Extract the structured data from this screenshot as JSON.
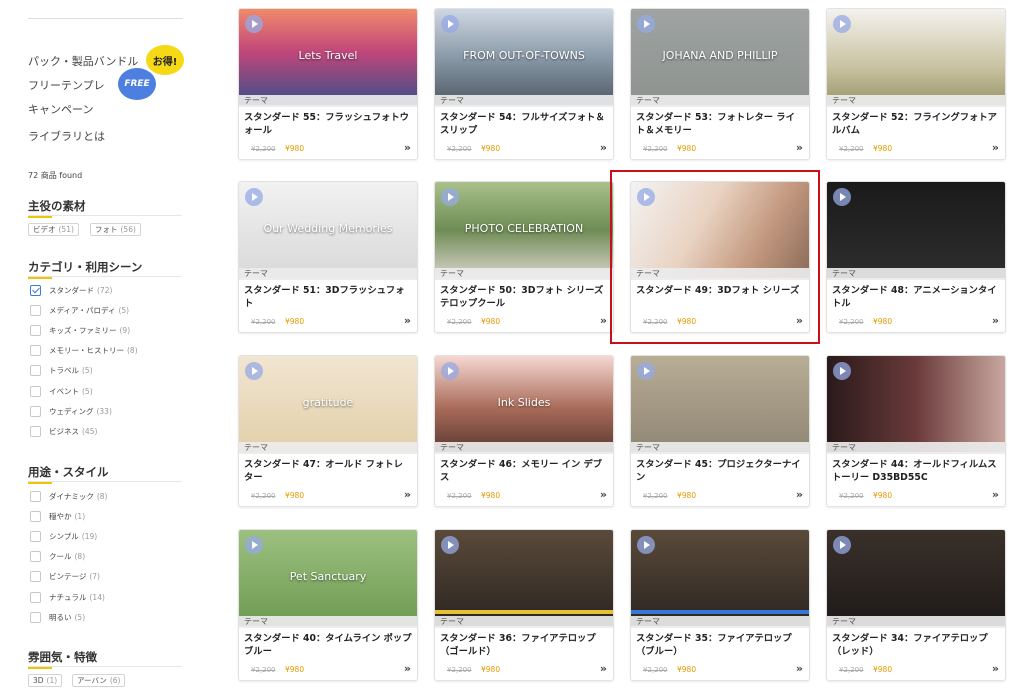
{
  "sidebar": {
    "links": [
      "パック・製品バンドル",
      "フリーテンプレ",
      "キャンペーン",
      "ライブラリとは"
    ],
    "badge_deal": "お得!",
    "badge_free": "FREE",
    "found_text": "72 商品 found",
    "main_material": {
      "title": "主役の素材",
      "tags": [
        {
          "label": "ビデオ",
          "count": "(51)"
        },
        {
          "label": "フォト",
          "count": "(56)"
        }
      ]
    },
    "category": {
      "title": "カテゴリ・利用シーン",
      "items": [
        {
          "label": "スタンダード",
          "count": "(72)",
          "checked": true
        },
        {
          "label": "メディア・パロディ",
          "count": "(5)",
          "checked": false
        },
        {
          "label": "キッズ・ファミリー",
          "count": "(9)",
          "checked": false
        },
        {
          "label": "メモリー・ヒストリー",
          "count": "(8)",
          "checked": false
        },
        {
          "label": "トラベル",
          "count": "(5)",
          "checked": false
        },
        {
          "label": "イベント",
          "count": "(5)",
          "checked": false
        },
        {
          "label": "ウェディング",
          "count": "(33)",
          "checked": false
        },
        {
          "label": "ビジネス",
          "count": "(45)",
          "checked": false
        }
      ]
    },
    "usage": {
      "title": "用途・スタイル",
      "items": [
        {
          "label": "ダイナミック",
          "count": "(8)"
        },
        {
          "label": "穏やか",
          "count": "(1)"
        },
        {
          "label": "シンプル",
          "count": "(19)"
        },
        {
          "label": "クール",
          "count": "(8)"
        },
        {
          "label": "ビンテージ",
          "count": "(7)"
        },
        {
          "label": "ナチュラル",
          "count": "(14)"
        },
        {
          "label": "明るい",
          "count": "(5)"
        }
      ]
    },
    "atmosphere": {
      "title": "雰囲気・特徴",
      "tags": [
        {
          "label": "3D",
          "count": "(1)"
        },
        {
          "label": "アーバン",
          "count": "(6)"
        }
      ]
    }
  },
  "products": [
    {
      "theme": "テーマ",
      "title": "スタンダード 55：フラッシュフォトウォール",
      "old_price": "¥2,200",
      "price": "¥980",
      "thumb_text": "Lets Travel",
      "bg": "linear-gradient(180deg,#f08a6a 0%,#c0467a 45%,#3a4f8a 100%)"
    },
    {
      "theme": "テーマ",
      "title": "スタンダード 54：フルサイズフォト＆スリップ",
      "old_price": "¥2,200",
      "price": "¥980",
      "thumb_text": "FROM OUT-OF-TOWNS",
      "bg": "linear-gradient(180deg,#cfd8e2 0%,#8a9aa8 50%,#4f5a64 100%)"
    },
    {
      "theme": "テーマ",
      "title": "スタンダード 53：フォトレター ライト＆メモリー",
      "old_price": "¥2,200",
      "price": "¥980",
      "thumb_text": "JOHANA AND PHILLIP",
      "bg": "linear-gradient(180deg,#9fa4a2 0%,#8d928f 100%)"
    },
    {
      "theme": "テーマ",
      "title": "スタンダード 52：フライングフォトアルバム",
      "old_price": "¥2,200",
      "price": "¥980",
      "thumb_text": "",
      "bg": "linear-gradient(180deg,#f4f2ee 0%,#c9c3a2 60%,#9a9568 100%)"
    },
    {
      "theme": "テーマ",
      "title": "スタンダード 51：3Dフラッシュフォト",
      "old_price": "¥2,200",
      "price": "¥980",
      "thumb_text": "Our Wedding Memories",
      "bg": "linear-gradient(180deg,#f2f2f2 0%,#d8d8d8 100%)"
    },
    {
      "theme": "テーマ",
      "title": "スタンダード 50：3Dフォト シリーズ テロップクール",
      "old_price": "¥2,200",
      "price": "¥980",
      "thumb_text": "PHOTO CELEBRATION",
      "bg": "linear-gradient(180deg,#a9c08a 0%,#6f8c55 50%,#d9d5cc 100%)"
    },
    {
      "theme": "テーマ",
      "title": "スタンダード 49：3Dフォト シリーズ",
      "old_price": "¥2,200",
      "price": "¥980",
      "thumb_text": "",
      "bg": "linear-gradient(120deg,#f3f3f3 0%,#e9d3c2 40%,#c49a80 70%,#8a6a58 100%)"
    },
    {
      "theme": "テーマ",
      "title": "スタンダード 48：アニメーションタイトル",
      "old_price": "¥2,200",
      "price": "¥980",
      "thumb_text": "",
      "bg": "linear-gradient(180deg,#1a1a1a 0%,#2e2e2e 100%)"
    },
    {
      "theme": "テーマ",
      "title": "スタンダード 47：オールド フォトレター",
      "old_price": "¥2,200",
      "price": "¥980",
      "thumb_text": "gratitude",
      "bg": "linear-gradient(180deg,#f1e6d2 0%,#e2cfa8 100%)"
    },
    {
      "theme": "テーマ",
      "title": "スタンダード 46：メモリー イン デブス",
      "old_price": "¥2,200",
      "price": "¥980",
      "thumb_text": "Ink Slides",
      "bg": "linear-gradient(180deg,#f6d8d2 0%,#a86a58 55%,#5a3a32 100%)"
    },
    {
      "theme": "テーマ",
      "title": "スタンダード 45：プロジェクターナイン",
      "old_price": "¥2,200",
      "price": "¥980",
      "thumb_text": "",
      "bg": "linear-gradient(180deg,#b8ad95 0%,#8f8674 100%)"
    },
    {
      "theme": "テーマ",
      "title": "スタンダード 44：オールドフィルムストーリー D35BD55C",
      "old_price": "¥2,200",
      "price": "¥980",
      "thumb_text": "",
      "bg": "linear-gradient(90deg,#2a1a1a 0%,#6a3a3a 50%,#c9a7a0 100%)"
    },
    {
      "theme": "テーマ",
      "title": "スタンダード 40：タイムライン ポップ ブルー",
      "old_price": "¥2,200",
      "price": "¥980",
      "thumb_text": "Pet Sanctuary",
      "bg": "linear-gradient(180deg,#9cc080 0%,#6e9a52 100%)"
    },
    {
      "theme": "テーマ",
      "title": "スタンダード 36：ファイアテロップ（ゴールド）",
      "old_price": "¥2,200",
      "price": "¥980",
      "thumb_text": "",
      "bg": "linear-gradient(180deg,#5a4a3a 0%,#2a2420 100%)",
      "stripe": "#e8c038"
    },
    {
      "theme": "テーマ",
      "title": "スタンダード 35：ファイアテロップ（ブルー）",
      "old_price": "¥2,200",
      "price": "¥980",
      "thumb_text": "",
      "bg": "linear-gradient(180deg,#5a4a3a 0%,#2a2420 100%)",
      "stripe": "#3a78d8"
    },
    {
      "theme": "テーマ",
      "title": "スタンダード 34：ファイアテロップ（レッド）",
      "old_price": "¥2,200",
      "price": "¥980",
      "thumb_text": "",
      "bg": "linear-gradient(180deg,#3a302a 0%,#1e1a18 100%)"
    }
  ]
}
